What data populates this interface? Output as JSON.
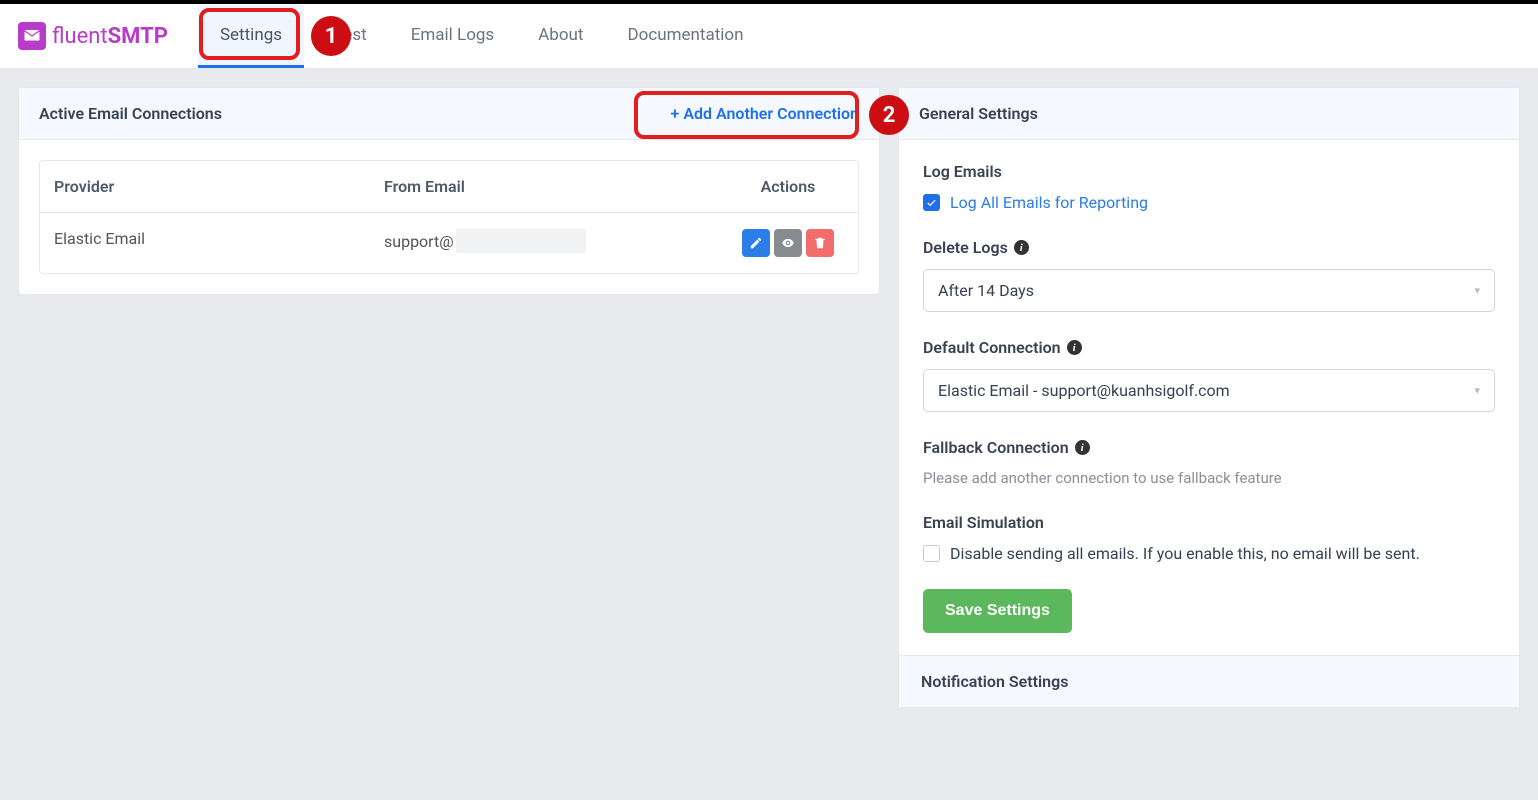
{
  "brand": {
    "fluent": "fluent",
    "smtp": "SMTP"
  },
  "nav": {
    "settings": "Settings",
    "email_test": "l Test",
    "email_logs": "Email Logs",
    "about": "About",
    "documentation": "Documentation"
  },
  "callouts": {
    "one": "1",
    "two": "2"
  },
  "left": {
    "title": "Active Email Connections",
    "add_label": "Add Another Connection",
    "table": {
      "headers": {
        "provider": "Provider",
        "email": "From Email",
        "actions": "Actions"
      },
      "rows": [
        {
          "provider": "Elastic Email",
          "email_prefix": "support@"
        }
      ]
    }
  },
  "right": {
    "title": "General Settings",
    "log_emails": {
      "label": "Log Emails",
      "checkbox": "Log All Emails for Reporting"
    },
    "delete_logs": {
      "label": "Delete Logs",
      "value": "After 14 Days"
    },
    "default_conn": {
      "label": "Default Connection",
      "value": "Elastic Email - support@kuanhsigolf.com"
    },
    "fallback": {
      "label": "Fallback Connection",
      "hint": "Please add another connection to use fallback feature"
    },
    "simulation": {
      "label": "Email Simulation",
      "checkbox": "Disable sending all emails. If you enable this, no email will be sent."
    },
    "save": "Save Settings",
    "notification": "Notification Settings"
  }
}
